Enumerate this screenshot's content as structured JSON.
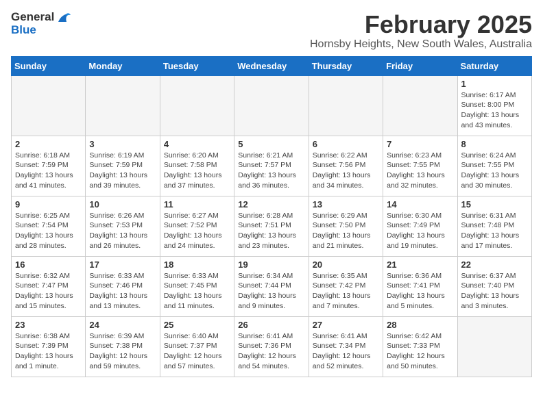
{
  "logo": {
    "line1": "General",
    "line2": "Blue"
  },
  "title": "February 2025",
  "location": "Hornsby Heights, New South Wales, Australia",
  "days_header": [
    "Sunday",
    "Monday",
    "Tuesday",
    "Wednesday",
    "Thursday",
    "Friday",
    "Saturday"
  ],
  "weeks": [
    [
      {
        "num": "",
        "info": ""
      },
      {
        "num": "",
        "info": ""
      },
      {
        "num": "",
        "info": ""
      },
      {
        "num": "",
        "info": ""
      },
      {
        "num": "",
        "info": ""
      },
      {
        "num": "",
        "info": ""
      },
      {
        "num": "1",
        "info": "Sunrise: 6:17 AM\nSunset: 8:00 PM\nDaylight: 13 hours\nand 43 minutes."
      }
    ],
    [
      {
        "num": "2",
        "info": "Sunrise: 6:18 AM\nSunset: 7:59 PM\nDaylight: 13 hours\nand 41 minutes."
      },
      {
        "num": "3",
        "info": "Sunrise: 6:19 AM\nSunset: 7:59 PM\nDaylight: 13 hours\nand 39 minutes."
      },
      {
        "num": "4",
        "info": "Sunrise: 6:20 AM\nSunset: 7:58 PM\nDaylight: 13 hours\nand 37 minutes."
      },
      {
        "num": "5",
        "info": "Sunrise: 6:21 AM\nSunset: 7:57 PM\nDaylight: 13 hours\nand 36 minutes."
      },
      {
        "num": "6",
        "info": "Sunrise: 6:22 AM\nSunset: 7:56 PM\nDaylight: 13 hours\nand 34 minutes."
      },
      {
        "num": "7",
        "info": "Sunrise: 6:23 AM\nSunset: 7:55 PM\nDaylight: 13 hours\nand 32 minutes."
      },
      {
        "num": "8",
        "info": "Sunrise: 6:24 AM\nSunset: 7:55 PM\nDaylight: 13 hours\nand 30 minutes."
      }
    ],
    [
      {
        "num": "9",
        "info": "Sunrise: 6:25 AM\nSunset: 7:54 PM\nDaylight: 13 hours\nand 28 minutes."
      },
      {
        "num": "10",
        "info": "Sunrise: 6:26 AM\nSunset: 7:53 PM\nDaylight: 13 hours\nand 26 minutes."
      },
      {
        "num": "11",
        "info": "Sunrise: 6:27 AM\nSunset: 7:52 PM\nDaylight: 13 hours\nand 24 minutes."
      },
      {
        "num": "12",
        "info": "Sunrise: 6:28 AM\nSunset: 7:51 PM\nDaylight: 13 hours\nand 23 minutes."
      },
      {
        "num": "13",
        "info": "Sunrise: 6:29 AM\nSunset: 7:50 PM\nDaylight: 13 hours\nand 21 minutes."
      },
      {
        "num": "14",
        "info": "Sunrise: 6:30 AM\nSunset: 7:49 PM\nDaylight: 13 hours\nand 19 minutes."
      },
      {
        "num": "15",
        "info": "Sunrise: 6:31 AM\nSunset: 7:48 PM\nDaylight: 13 hours\nand 17 minutes."
      }
    ],
    [
      {
        "num": "16",
        "info": "Sunrise: 6:32 AM\nSunset: 7:47 PM\nDaylight: 13 hours\nand 15 minutes."
      },
      {
        "num": "17",
        "info": "Sunrise: 6:33 AM\nSunset: 7:46 PM\nDaylight: 13 hours\nand 13 minutes."
      },
      {
        "num": "18",
        "info": "Sunrise: 6:33 AM\nSunset: 7:45 PM\nDaylight: 13 hours\nand 11 minutes."
      },
      {
        "num": "19",
        "info": "Sunrise: 6:34 AM\nSunset: 7:44 PM\nDaylight: 13 hours\nand 9 minutes."
      },
      {
        "num": "20",
        "info": "Sunrise: 6:35 AM\nSunset: 7:42 PM\nDaylight: 13 hours\nand 7 minutes."
      },
      {
        "num": "21",
        "info": "Sunrise: 6:36 AM\nSunset: 7:41 PM\nDaylight: 13 hours\nand 5 minutes."
      },
      {
        "num": "22",
        "info": "Sunrise: 6:37 AM\nSunset: 7:40 PM\nDaylight: 13 hours\nand 3 minutes."
      }
    ],
    [
      {
        "num": "23",
        "info": "Sunrise: 6:38 AM\nSunset: 7:39 PM\nDaylight: 13 hours\nand 1 minute."
      },
      {
        "num": "24",
        "info": "Sunrise: 6:39 AM\nSunset: 7:38 PM\nDaylight: 12 hours\nand 59 minutes."
      },
      {
        "num": "25",
        "info": "Sunrise: 6:40 AM\nSunset: 7:37 PM\nDaylight: 12 hours\nand 57 minutes."
      },
      {
        "num": "26",
        "info": "Sunrise: 6:41 AM\nSunset: 7:36 PM\nDaylight: 12 hours\nand 54 minutes."
      },
      {
        "num": "27",
        "info": "Sunrise: 6:41 AM\nSunset: 7:34 PM\nDaylight: 12 hours\nand 52 minutes."
      },
      {
        "num": "28",
        "info": "Sunrise: 6:42 AM\nSunset: 7:33 PM\nDaylight: 12 hours\nand 50 minutes."
      },
      {
        "num": "",
        "info": ""
      }
    ]
  ]
}
